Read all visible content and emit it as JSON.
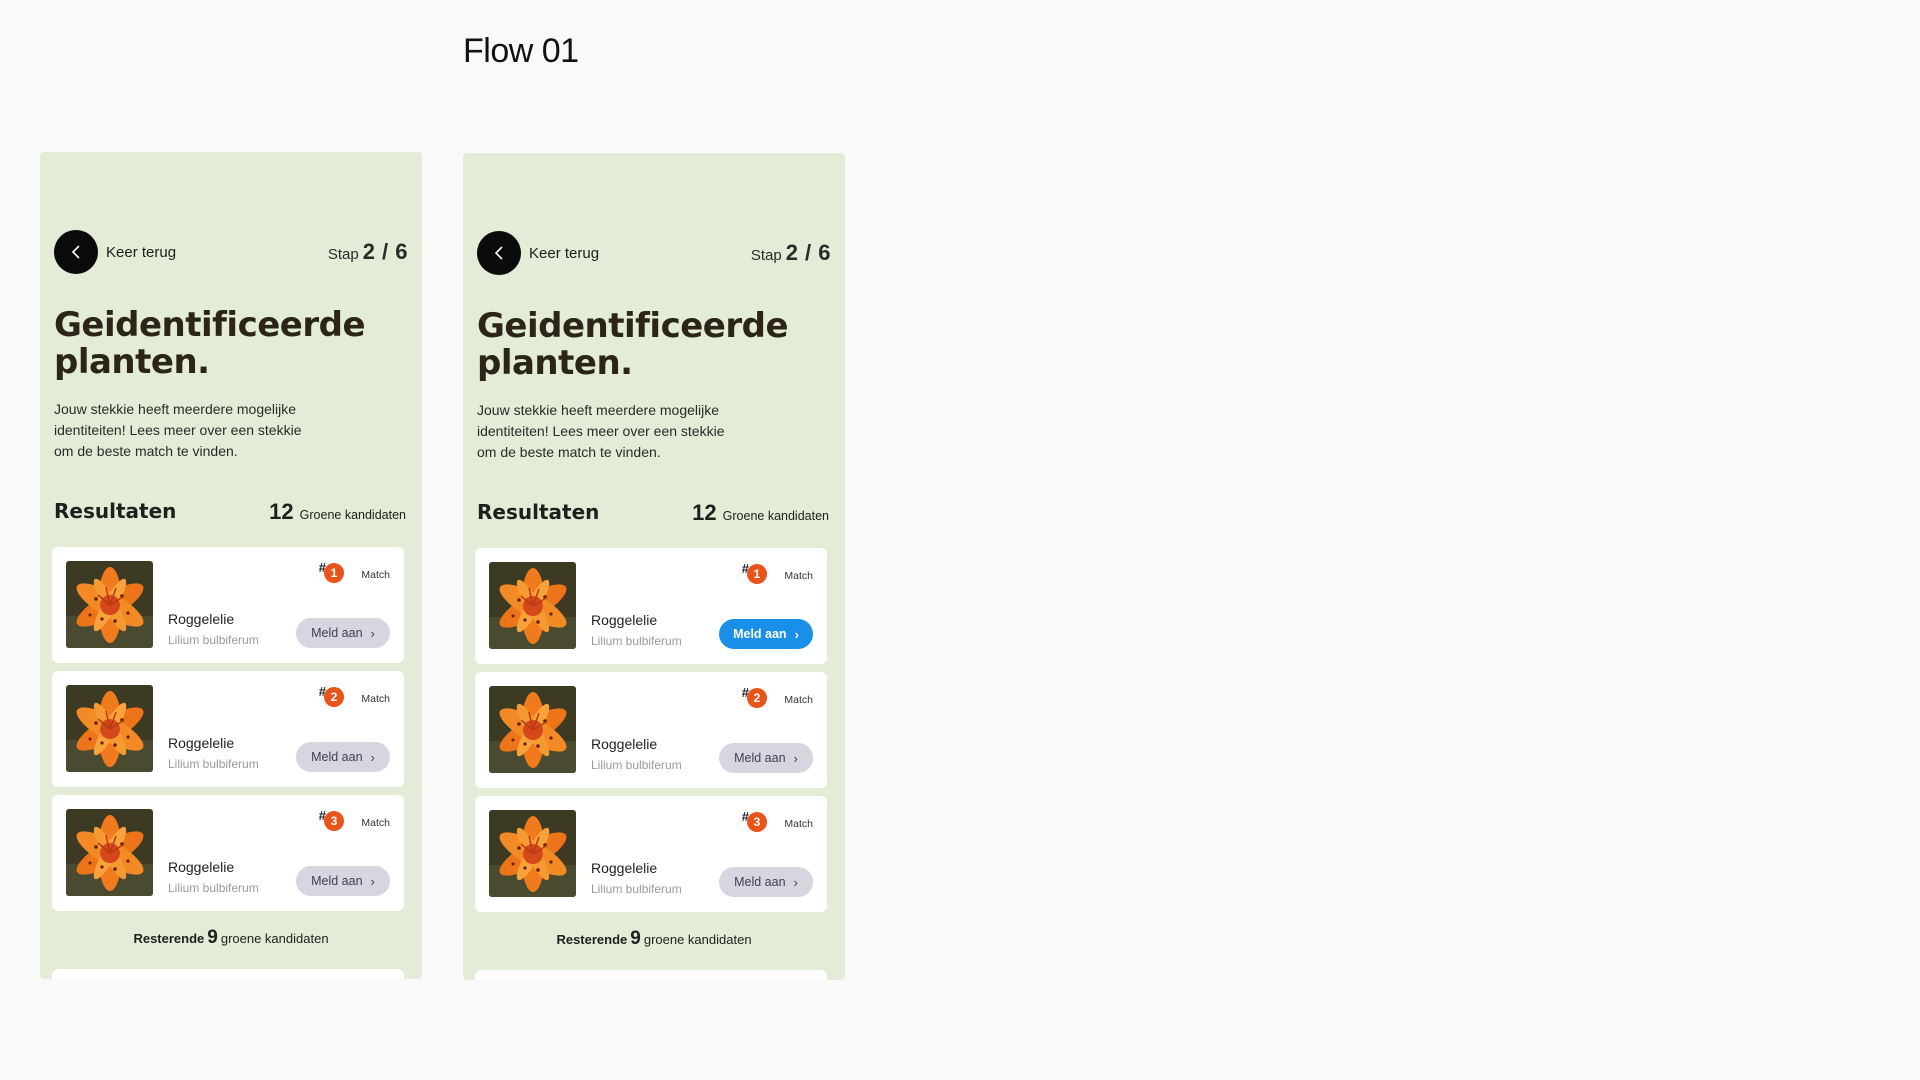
{
  "flow_title": "Flow 01",
  "screens": [
    {
      "back_label": "Keer terug",
      "step_word": "Stap",
      "step_value": "2 / 6",
      "heading": "Geidentificeerde planten.",
      "intro": "Jouw stekkie heeft meerdere mogelijke identiteiten! Lees meer over een stekkie om de beste match te vinden.",
      "results_title": "Resultaten",
      "results_count": "12",
      "results_count_label": "Groene kandidaten",
      "cards": [
        {
          "rank": "1",
          "hash": "#",
          "match_label": "Match",
          "name": "Roggelelie",
          "latin": "Lilium bulbiferum",
          "button": "Meld aan",
          "chevron": "›",
          "active": false
        },
        {
          "rank": "2",
          "hash": "#",
          "match_label": "Match",
          "name": "Roggelelie",
          "latin": "Lilium bulbiferum",
          "button": "Meld aan",
          "chevron": "›",
          "active": false
        },
        {
          "rank": "3",
          "hash": "#",
          "match_label": "Match",
          "name": "Roggelelie",
          "latin": "Lilium bulbiferum",
          "button": "Meld aan",
          "chevron": "›",
          "active": false
        }
      ],
      "remaining_prefix": "Resterende",
      "remaining_count": "9",
      "remaining_suffix": "groene kandidaten"
    },
    {
      "back_label": "Keer terug",
      "step_word": "Stap",
      "step_value": "2 / 6",
      "heading": "Geidentificeerde planten.",
      "intro": "Jouw stekkie heeft meerdere mogelijke identiteiten! Lees meer over een stekkie om de beste match te vinden.",
      "results_title": "Resultaten",
      "results_count": "12",
      "results_count_label": "Groene kandidaten",
      "cards": [
        {
          "rank": "1",
          "hash": "#",
          "match_label": "Match",
          "name": "Roggelelie",
          "latin": "Lilium bulbiferum",
          "button": "Meld aan",
          "chevron": "›",
          "active": true
        },
        {
          "rank": "2",
          "hash": "#",
          "match_label": "Match",
          "name": "Roggelelie",
          "latin": "Lilium bulbiferum",
          "button": "Meld aan",
          "chevron": "›",
          "active": false
        },
        {
          "rank": "3",
          "hash": "#",
          "match_label": "Match",
          "name": "Roggelelie",
          "latin": "Lilium bulbiferum",
          "button": "Meld aan",
          "chevron": "›",
          "active": false
        }
      ],
      "remaining_prefix": "Resterende",
      "remaining_count": "9",
      "remaining_suffix": "groene kandidaten"
    }
  ],
  "colors": {
    "screen_bg": "#e2ecd6",
    "badge": "#e8541a",
    "button_inactive": "#d6d6e0",
    "button_active": "#1a8fe8",
    "heading_text": "#2d2418"
  },
  "icons": {
    "back": "chevron-left-icon",
    "plant_image": "orange-lily-image"
  }
}
